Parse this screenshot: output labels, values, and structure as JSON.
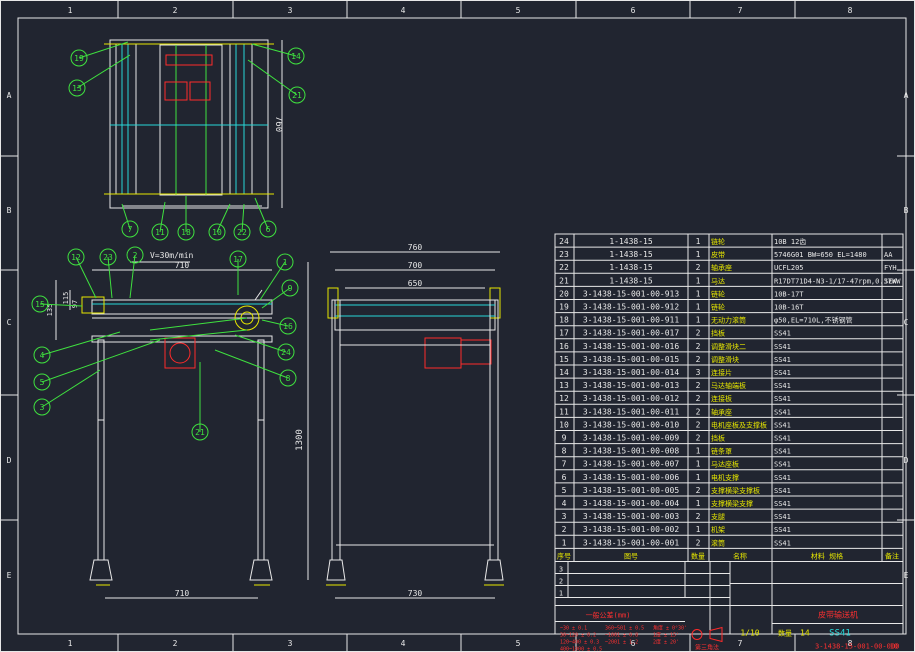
{
  "grid": {
    "top_cols": [
      "1",
      "2",
      "3",
      "4",
      "5",
      "6",
      "7",
      "8"
    ],
    "rows": [
      "A",
      "B",
      "C",
      "D",
      "E"
    ]
  },
  "top_view": {
    "dim_height": "760",
    "balloons": [
      "19",
      "13",
      "14",
      "21",
      "7",
      "11",
      "18",
      "10",
      "22",
      "6"
    ]
  },
  "front_view": {
    "speed": "V=30m/min",
    "dim_width": "710",
    "dim_bottom": "710",
    "dim_height": "1300",
    "dim_135": "135",
    "dim_115": "115",
    "dim_97": "97",
    "balloons": [
      "12",
      "23",
      "2",
      "17",
      "1",
      "9",
      "15",
      "4",
      "5",
      "3",
      "16",
      "24",
      "8",
      "21"
    ]
  },
  "side_view": {
    "dims": [
      "760",
      "700",
      "650",
      "730"
    ]
  },
  "bom": [
    {
      "no": "24",
      "code": "1-1438-15",
      "qty": "1",
      "name": "链轮",
      "spec": "10B  12齿",
      "note": ""
    },
    {
      "no": "23",
      "code": "1-1438-15",
      "qty": "1",
      "name": "皮带",
      "spec": "5746G01 BW=650 EL=1480",
      "note": "AA"
    },
    {
      "no": "22",
      "code": "1-1438-15",
      "qty": "2",
      "name": "轴承座",
      "spec": "UCFL205",
      "note": "FYH"
    },
    {
      "no": "21",
      "code": "1-1438-15",
      "qty": "1",
      "name": "马达",
      "spec": "R17DT71D4-N3-1/17-47rpm,0.37KW",
      "note": "SEW"
    },
    {
      "no": "20",
      "code": "3-1438-15-001-00-913",
      "qty": "1",
      "name": "链轮",
      "spec": "10B-17T",
      "note": ""
    },
    {
      "no": "19",
      "code": "3-1438-15-001-00-912",
      "qty": "1",
      "name": "链轮",
      "spec": "10B-16T",
      "note": ""
    },
    {
      "no": "18",
      "code": "3-1438-15-001-00-911",
      "qty": "1",
      "name": "无动力滚筒",
      "spec": "φ50,EL=710L,不锈钢管",
      "note": ""
    },
    {
      "no": "17",
      "code": "3-1438-15-001-00-017",
      "qty": "2",
      "name": "挡板",
      "spec": "SS41",
      "note": ""
    },
    {
      "no": "16",
      "code": "3-1438-15-001-00-016",
      "qty": "2",
      "name": "调整滑块二",
      "spec": "SS41",
      "note": ""
    },
    {
      "no": "15",
      "code": "3-1438-15-001-00-015",
      "qty": "2",
      "name": "调整滑块",
      "spec": "SS41",
      "note": ""
    },
    {
      "no": "14",
      "code": "3-1438-15-001-00-014",
      "qty": "3",
      "name": "连接片",
      "spec": "SS41",
      "note": ""
    },
    {
      "no": "13",
      "code": "3-1438-15-001-00-013",
      "qty": "2",
      "name": "马达轴端板",
      "spec": "SS41",
      "note": ""
    },
    {
      "no": "12",
      "code": "3-1438-15-001-00-012",
      "qty": "2",
      "name": "连接板",
      "spec": "SS41",
      "note": ""
    },
    {
      "no": "11",
      "code": "3-1438-15-001-00-011",
      "qty": "2",
      "name": "轴承座",
      "spec": "SS41",
      "note": ""
    },
    {
      "no": "10",
      "code": "3-1438-15-001-00-010",
      "qty": "2",
      "name": "电机座板及支撑板",
      "spec": "SS41",
      "note": ""
    },
    {
      "no": "9",
      "code": "3-1438-15-001-00-009",
      "qty": "2",
      "name": "挡板",
      "spec": "SS41",
      "note": ""
    },
    {
      "no": "8",
      "code": "3-1438-15-001-00-008",
      "qty": "1",
      "name": "链条罩",
      "spec": "SS41",
      "note": ""
    },
    {
      "no": "7",
      "code": "3-1438-15-001-00-007",
      "qty": "1",
      "name": "马达座板",
      "spec": "SS41",
      "note": ""
    },
    {
      "no": "6",
      "code": "3-1438-15-001-00-006",
      "qty": "1",
      "name": "电机支撑",
      "spec": "SS41",
      "note": ""
    },
    {
      "no": "5",
      "code": "3-1438-15-001-00-005",
      "qty": "2",
      "name": "支撑横梁支撑板",
      "spec": "SS41",
      "note": ""
    },
    {
      "no": "4",
      "code": "3-1438-15-001-00-004",
      "qty": "1",
      "name": "支撑横梁支撑",
      "spec": "SS41",
      "note": ""
    },
    {
      "no": "3",
      "code": "3-1438-15-001-00-003",
      "qty": "2",
      "name": "支腿",
      "spec": "SS41",
      "note": ""
    },
    {
      "no": "2",
      "code": "3-1438-15-001-00-002",
      "qty": "1",
      "name": "机架",
      "spec": "SS41",
      "note": ""
    },
    {
      "no": "1",
      "code": "3-1438-15-001-00-001",
      "qty": "2",
      "name": "滚筒",
      "spec": "SS41",
      "note": ""
    }
  ],
  "bom_header": {
    "no": "序号",
    "code": "图号",
    "qty": "数量",
    "name": "名称",
    "spec": "材料  规格",
    "note": "备注"
  },
  "title_block": {
    "rev_rows": [
      "3",
      "2",
      "1"
    ],
    "scale": "1/10",
    "material": "SS41",
    "drawing_name": "皮带输送机",
    "qty_label": "数量",
    "qty_value": "14",
    "drawing_no": "3-1438-15-001-00-000",
    "sheet": "10",
    "tolerance_title": "一般公差(mm)",
    "tolerances": [
      "~30 ± 0.1",
      "30~120 ± 0.2",
      "120~400 ± 0.3",
      "400~1000 ± 0.5",
      "360~501 ± 0.5",
      "~1001 ± 0.8",
      "~2001 ± 1.2"
    ],
    "angle_tol": [
      "角度 ± 0°30'",
      "1度 ± 15'",
      "2度 ± 20'"
    ],
    "projection": "第三角法"
  }
}
